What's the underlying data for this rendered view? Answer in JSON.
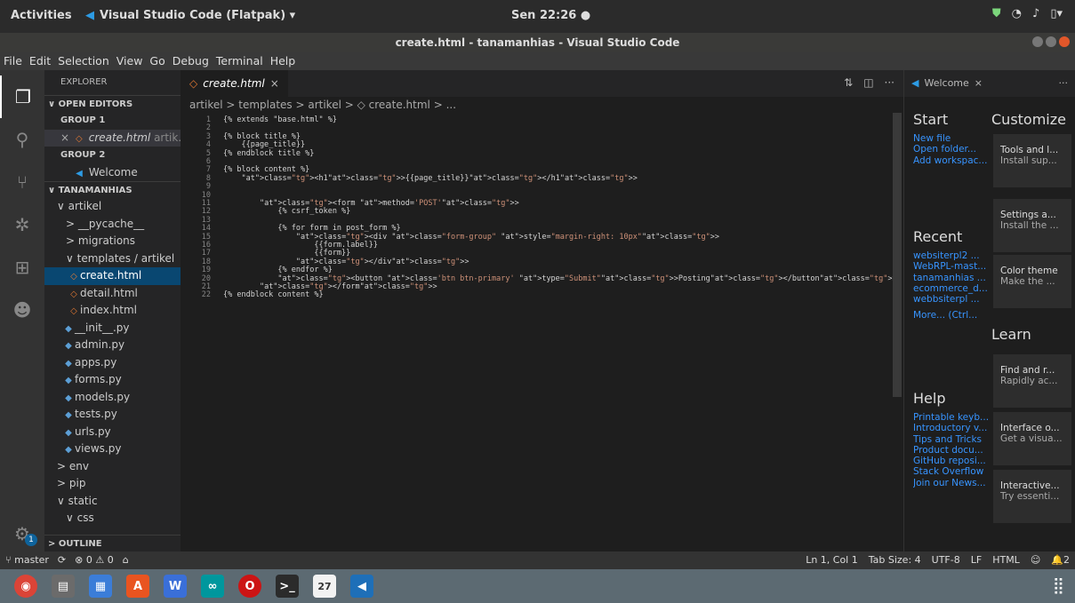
{
  "topbar": {
    "activities": "Activities",
    "app": "Visual Studio Code (Flatpak) ▾",
    "clock": "Sen 22:26 ●"
  },
  "window": {
    "title": "create.html - tanamanhias - Visual Studio Code"
  },
  "menu": [
    "File",
    "Edit",
    "Selection",
    "View",
    "Go",
    "Debug",
    "Terminal",
    "Help"
  ],
  "sidebar": {
    "header": "EXPLORER",
    "open_editors": "OPEN EDITORS",
    "group1": "GROUP 1",
    "open_file": "create.html",
    "open_file_path": "artik...",
    "group2": "GROUP 2",
    "welcome": "Welcome",
    "project": "TANAMANHIAS",
    "tree": [
      {
        "label": "artikel",
        "prefix": "∨",
        "indent": 14,
        "icon": ""
      },
      {
        "label": "__pycache__",
        "prefix": ">",
        "indent": 24,
        "icon": ""
      },
      {
        "label": "migrations",
        "prefix": ">",
        "indent": 24,
        "icon": ""
      },
      {
        "label": "templates / artikel",
        "prefix": "∨",
        "indent": 24,
        "icon": ""
      },
      {
        "label": "create.html",
        "prefix": "",
        "indent": 26,
        "icon": "html",
        "selected": true
      },
      {
        "label": "detail.html",
        "prefix": "",
        "indent": 26,
        "icon": "html"
      },
      {
        "label": "index.html",
        "prefix": "",
        "indent": 26,
        "icon": "html"
      },
      {
        "label": "__init__.py",
        "prefix": "",
        "indent": 20,
        "icon": "py"
      },
      {
        "label": "admin.py",
        "prefix": "",
        "indent": 20,
        "icon": "py"
      },
      {
        "label": "apps.py",
        "prefix": "",
        "indent": 20,
        "icon": "py"
      },
      {
        "label": "forms.py",
        "prefix": "",
        "indent": 20,
        "icon": "py"
      },
      {
        "label": "models.py",
        "prefix": "",
        "indent": 20,
        "icon": "py"
      },
      {
        "label": "tests.py",
        "prefix": "",
        "indent": 20,
        "icon": "py"
      },
      {
        "label": "urls.py",
        "prefix": "",
        "indent": 20,
        "icon": "py"
      },
      {
        "label": "views.py",
        "prefix": "",
        "indent": 20,
        "icon": "py"
      },
      {
        "label": "env",
        "prefix": ">",
        "indent": 14,
        "icon": ""
      },
      {
        "label": "pip",
        "prefix": ">",
        "indent": 14,
        "icon": ""
      },
      {
        "label": "static",
        "prefix": "∨",
        "indent": 14,
        "icon": ""
      },
      {
        "label": "css",
        "prefix": "∨",
        "indent": 24,
        "icon": ""
      }
    ],
    "outline": "OUTLINE",
    "settings_badge": "1"
  },
  "editor": {
    "tab": "create.html",
    "breadcrumb": "artikel > templates > artikel > ◇ create.html > ...",
    "lines": [
      "{% extends \"base.html\" %}",
      "",
      "{% block title %}",
      "    {{page_title}}",
      "{% endblock title %}",
      "",
      "{% block content %}",
      "    <h1>{{page_title}}</h1>",
      "",
      "",
      "        <form method='POST'>",
      "            {% csrf_token %}",
      "",
      "            {% for form in post_form %}",
      "                <div class=\"form-group\" style=\"margin-right: 10px\">",
      "                    {{form.label}}",
      "                    {{form}}",
      "                </div>",
      "            {% endfor %}",
      "            <button class='btn btn-primary' type=\"Submit\">Posting</button>",
      "        </form>",
      "{% endblock content %}"
    ]
  },
  "welcome": {
    "tab": "Welcome",
    "start": "Start",
    "start_links": [
      "New file",
      "Open folder...",
      "Add workspac..."
    ],
    "recent": "Recent",
    "recent_links": [
      "websiterpl2 ...",
      "WebRPL-mast...",
      "tanamanhias ...",
      "ecommerce_d...",
      "webbsiterpl ..."
    ],
    "more": "More...  (Ctrl...",
    "help": "Help",
    "help_links": [
      "Printable keyb...",
      "Introductory v...",
      "Tips and Tricks",
      "Product docu...",
      "GitHub reposi...",
      "Stack Overflow",
      "Join our News..."
    ],
    "customize": "Customize",
    "learn": "Learn",
    "cards": [
      {
        "t": "Tools and l...",
        "s": "Install sup..."
      },
      {
        "t": "Settings a...",
        "s": "Install the ..."
      },
      {
        "t": "Color theme",
        "s": "Make the ..."
      },
      {
        "t": "Find and r...",
        "s": "Rapidly ac..."
      },
      {
        "t": "Interface o...",
        "s": "Get a visua..."
      },
      {
        "t": "Interactive...",
        "s": "Try essenti..."
      }
    ]
  },
  "status": {
    "branch": "master",
    "sync": "⟳",
    "problems": "⊗ 0 ⚠ 0",
    "right": [
      "Ln 1, Col 1",
      "Tab Size: 4",
      "UTF-8",
      "LF",
      "HTML",
      "☺",
      "🔔2"
    ]
  },
  "dock": [
    "chrome",
    "files",
    "writer",
    "store",
    "wps",
    "arduino",
    "opera",
    "terminal",
    "calendar",
    "vscode"
  ]
}
